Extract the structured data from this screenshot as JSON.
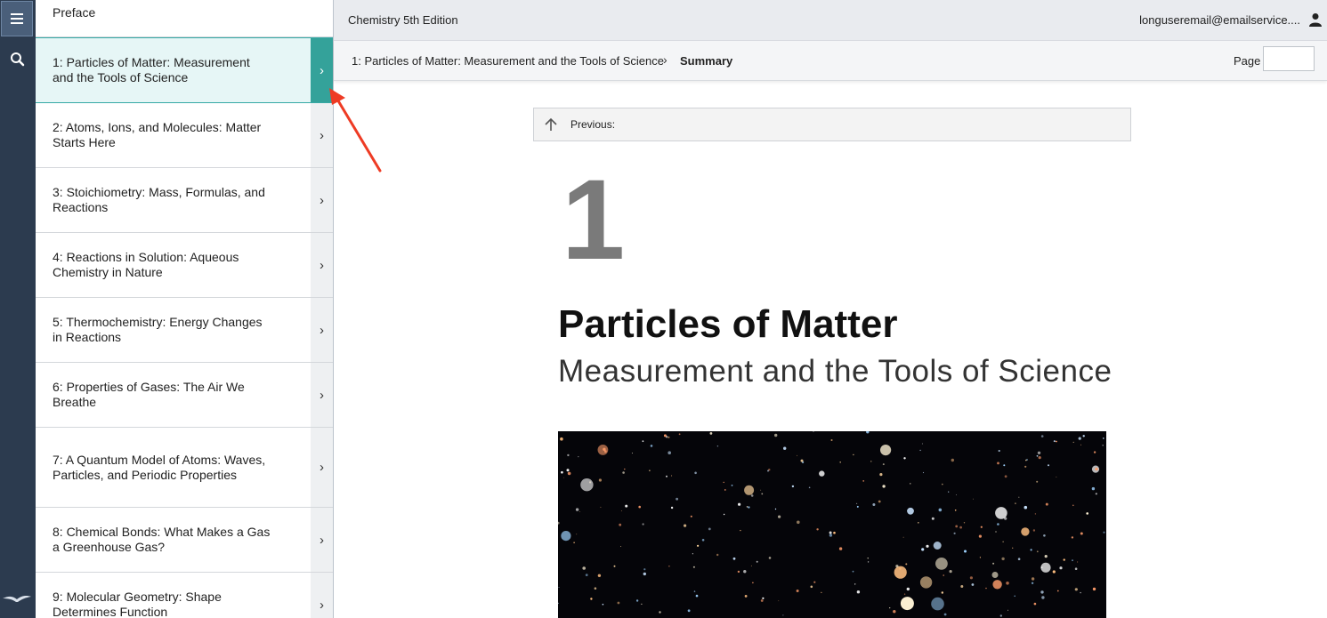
{
  "rail": {
    "menu_icon": "hamburger-icon",
    "search_icon": "search-icon",
    "logo_icon": "bird-logo-icon"
  },
  "toc": {
    "items": [
      {
        "label": "Preface"
      },
      {
        "label": "1: Particles of Matter: Measurement and the Tools of Science",
        "active": true
      },
      {
        "label": "2: Atoms, Ions, and Molecules: Matter Starts Here"
      },
      {
        "label": "3: Stoichiometry: Mass, Formulas, and Reactions"
      },
      {
        "label": "4: Reactions in Solution: Aqueous Chemistry in Nature"
      },
      {
        "label": "5: Thermochemistry: Energy Changes in Reactions"
      },
      {
        "label": "6: Properties of Gases: The Air We Breathe"
      },
      {
        "label": "7: A Quantum Model of Atoms: Waves, Particles, and Periodic Properties"
      },
      {
        "label": "8: Chemical Bonds: What Makes a Gas a Greenhouse Gas?"
      },
      {
        "label": "9: Molecular Geometry: Shape Determines Function"
      }
    ],
    "chevron": "›"
  },
  "topbar": {
    "book_title": "Chemistry 5th Edition",
    "user": "longuseremail@emailservice....",
    "user_icon": "user-icon"
  },
  "breadcrumb": {
    "chapter": "1: Particles of Matter: Measurement and the Tools of Science",
    "separator": "›",
    "current": "Summary",
    "page_label": "Page",
    "page_value": ""
  },
  "content": {
    "previous_label": "Previous:",
    "chapter_number": "1",
    "title": "Particles of Matter",
    "subtitle": "Measurement and the Tools of Science",
    "image": "deep-field-galaxies-image"
  },
  "colors": {
    "rail": "#2c3b4f",
    "accent_teal": "#34a29a",
    "active_bg": "#e6f6f6",
    "annotation_red": "#ee3b24"
  }
}
